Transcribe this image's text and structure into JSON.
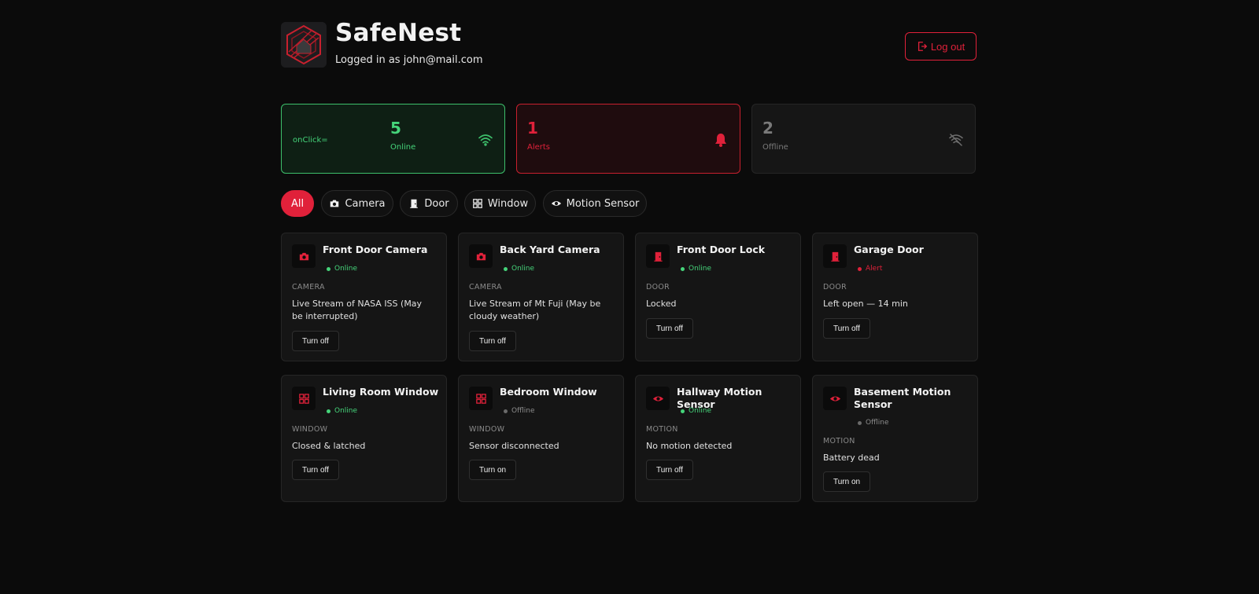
{
  "app": {
    "title": "SafeNest",
    "user_line": "Logged in as john@mail.com",
    "logout_label": "Log out"
  },
  "stats": {
    "online": {
      "prefix": "onClick=",
      "count": "5",
      "label": "Online",
      "icon": "wifi-icon",
      "color": "#45d47a"
    },
    "alerts": {
      "count": "1",
      "label": "Alerts",
      "icon": "bell-icon",
      "color": "#e0213a"
    },
    "offline": {
      "count": "2",
      "label": "Offline",
      "icon": "wifi-off-icon",
      "color": "#7a7a7a"
    }
  },
  "filters": [
    {
      "label": "All",
      "icon": "",
      "active": true
    },
    {
      "label": "Camera",
      "icon": "camera-icon",
      "active": false
    },
    {
      "label": "Door",
      "icon": "door-icon",
      "active": false
    },
    {
      "label": "Window",
      "icon": "window-icon",
      "active": false
    },
    {
      "label": "Motion Sensor",
      "icon": "eye-icon",
      "active": false
    }
  ],
  "devices": [
    {
      "name": "Front Door Camera",
      "status": "Online",
      "type": "CAMERA",
      "desc": "Live Stream of NASA ISS (May be interrupted)",
      "button": "Turn off",
      "icon": "camera-icon"
    },
    {
      "name": "Back Yard Camera",
      "status": "Online",
      "type": "CAMERA",
      "desc": "Live Stream of Mt Fuji (May be cloudy weather)",
      "button": "Turn off",
      "icon": "camera-icon"
    },
    {
      "name": "Front Door Lock",
      "status": "Online",
      "type": "DOOR",
      "desc": "Locked",
      "button": "Turn off",
      "icon": "door-icon"
    },
    {
      "name": "Garage Door",
      "status": "Alert",
      "type": "DOOR",
      "desc": "Left open — 14 min",
      "button": "Turn off",
      "icon": "door-icon"
    },
    {
      "name": "Living Room Window",
      "status": "Online",
      "type": "WINDOW",
      "desc": "Closed & latched",
      "button": "Turn off",
      "icon": "window-icon"
    },
    {
      "name": "Bedroom Window",
      "status": "Offline",
      "type": "WINDOW",
      "desc": "Sensor disconnected",
      "button": "Turn on",
      "icon": "window-icon"
    },
    {
      "name": "Hallway Motion Sensor",
      "status": "Online",
      "type": "MOTION",
      "desc": "No motion detected",
      "button": "Turn off",
      "icon": "eye-icon"
    },
    {
      "name": "Basement Motion Sensor",
      "status": "Offline",
      "type": "MOTION",
      "desc": "Battery dead",
      "button": "Turn on",
      "icon": "eye-icon"
    }
  ],
  "colors": {
    "accent": "#e0213a",
    "online": "#45d47a",
    "offline": "#6a6a6a",
    "background": "#0b0b0b",
    "card": "#151515"
  }
}
